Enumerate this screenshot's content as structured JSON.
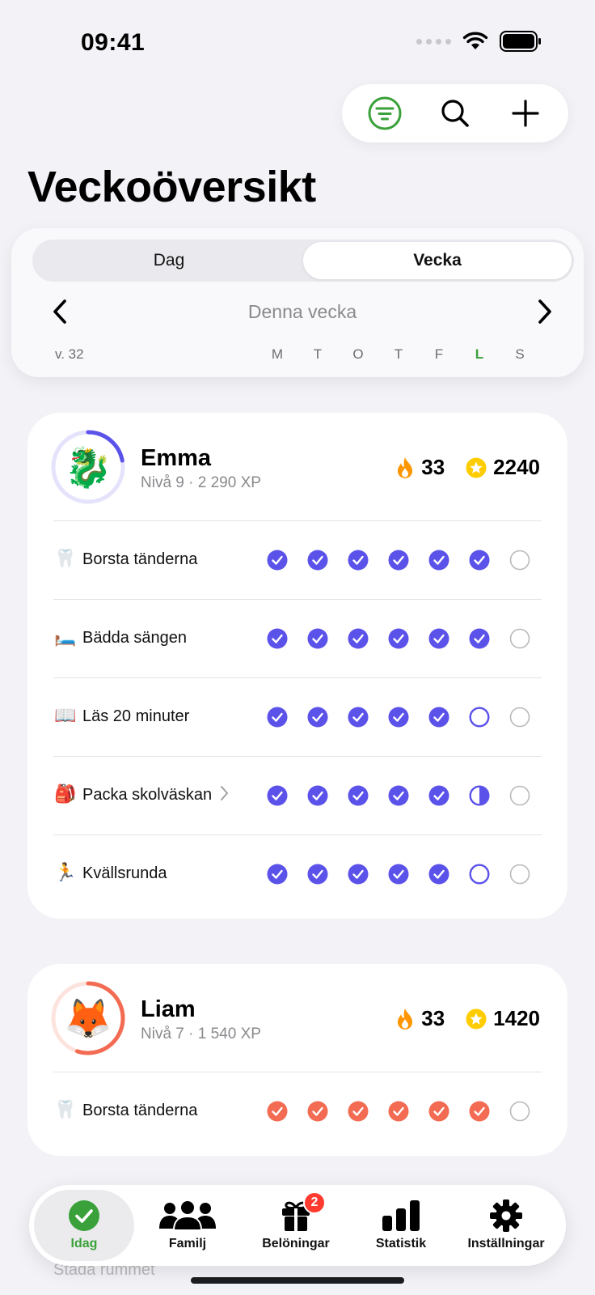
{
  "status_bar": {
    "time": "09:41"
  },
  "top_actions": [
    {
      "name": "filter",
      "icon": "filter-icon"
    },
    {
      "name": "search",
      "icon": "search-icon"
    },
    {
      "name": "add",
      "icon": "plus-icon"
    }
  ],
  "page": {
    "title": "Veckoöversikt"
  },
  "week_panel": {
    "segments": [
      {
        "label": "Dag",
        "active": false
      },
      {
        "label": "Vecka",
        "active": true
      }
    ],
    "current_label": "Denna vecka",
    "week_number": "v. 32",
    "days": [
      "M",
      "T",
      "O",
      "T",
      "F",
      "L",
      "S"
    ],
    "today_index": 5
  },
  "colors": {
    "accent_green": "#3aa13a",
    "emma_check": "#5b52ea",
    "liam_check": "#f26b52",
    "badge_red": "#ff3b30",
    "streak_orange": "#ff9500",
    "star_yellow": "#ffcc00"
  },
  "children": [
    {
      "name": "Emma",
      "avatar": "🐉",
      "subtitle": "Nivå 9 · 2 290 XP",
      "streak": "33",
      "points": "2240",
      "ring_color": "#5b52ea",
      "ring_track": "#e4e3fb",
      "level_progress": 0.22,
      "tasks": [
        {
          "icon": "🦷",
          "label": "Borsta tänderna",
          "has_chevron": false,
          "days": [
            "done",
            "done",
            "done",
            "done",
            "done",
            "done",
            "empty"
          ]
        },
        {
          "icon": "🛏️",
          "label": "Bädda sängen",
          "has_chevron": false,
          "days": [
            "done",
            "done",
            "done",
            "done",
            "done",
            "done",
            "empty"
          ]
        },
        {
          "icon": "📖",
          "label": "Läs 20 minuter",
          "has_chevron": false,
          "days": [
            "done",
            "done",
            "done",
            "done",
            "done",
            "open",
            "empty"
          ]
        },
        {
          "icon": "🎒",
          "label": "Packa skolväskan",
          "has_chevron": true,
          "days": [
            "done",
            "done",
            "done",
            "done",
            "done",
            "half",
            "empty"
          ]
        },
        {
          "icon": "🏃",
          "label": "Kvällsrunda",
          "has_chevron": false,
          "days": [
            "done",
            "done",
            "done",
            "done",
            "done",
            "open",
            "empty"
          ]
        }
      ]
    },
    {
      "name": "Liam",
      "avatar": "🦊",
      "subtitle": "Nivå 7 · 1 540 XP",
      "streak": "33",
      "points": "1420",
      "ring_color": "#f26b52",
      "ring_track": "#fde3de",
      "level_progress": 0.55,
      "tasks": [
        {
          "icon": "🦷",
          "label": "Borsta tänderna",
          "has_chevron": false,
          "days": [
            "done",
            "done",
            "done",
            "done",
            "done",
            "done",
            "empty"
          ]
        }
      ]
    }
  ],
  "hidden_row_label": "Städa rummet",
  "tab_bar": [
    {
      "label": "Idag",
      "icon": "checkmark-circle-icon",
      "active": true,
      "badge": null
    },
    {
      "label": "Familj",
      "icon": "people-icon",
      "active": false,
      "badge": null
    },
    {
      "label": "Belöningar",
      "icon": "gift-icon",
      "active": false,
      "badge": "2"
    },
    {
      "label": "Statistik",
      "icon": "bar-chart-icon",
      "active": false,
      "badge": null
    },
    {
      "label": "Inställningar",
      "icon": "gear-icon",
      "active": false,
      "badge": null
    }
  ]
}
